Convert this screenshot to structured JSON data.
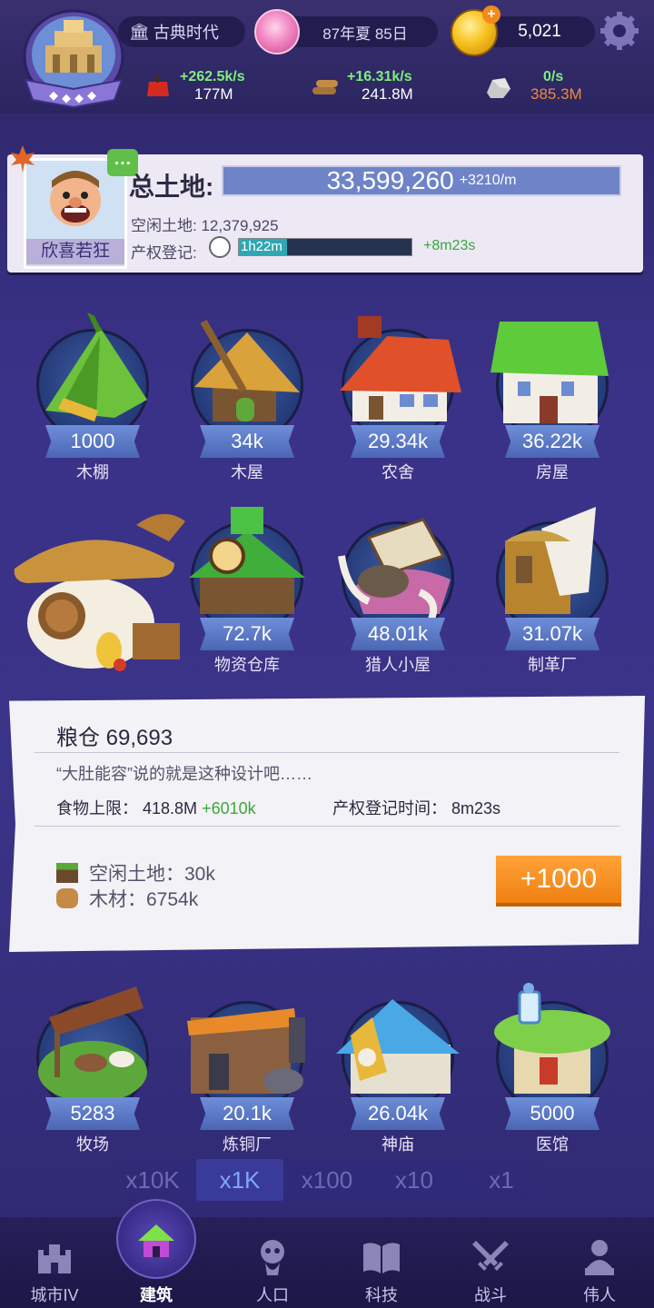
{
  "topbar": {
    "era": "古典时代",
    "date": "87年夏 85日",
    "coins": "5,021",
    "resources": [
      {
        "icon": "apple-icon",
        "rate": "+262.5k/s",
        "amount": "177M"
      },
      {
        "icon": "wood-icon",
        "rate": "+16.31k/s",
        "amount": "241.8M"
      },
      {
        "icon": "stone-icon",
        "rate": "0/s",
        "amount": "385.3M"
      }
    ]
  },
  "land": {
    "leader_name": "欣喜若狂",
    "title": "总土地:",
    "total": "33,599,260",
    "rate": "+3210/m",
    "idle_label": "空闲土地: 12,379,925",
    "register_label": "产权登记:",
    "register_time": "1h22m",
    "register_plus": "+8m23s",
    "register_progress": 0.28
  },
  "buildings_row1": [
    {
      "id": "tent",
      "count": "1000",
      "name": "木棚"
    },
    {
      "id": "hut",
      "count": "34k",
      "name": "木屋"
    },
    {
      "id": "farmhouse",
      "count": "29.34k",
      "name": "农舍"
    },
    {
      "id": "house",
      "count": "36.22k",
      "name": "房屋"
    }
  ],
  "buildings_row2": [
    {
      "id": "granary",
      "count": "",
      "name": ""
    },
    {
      "id": "warehouse",
      "count": "72.7k",
      "name": "物资仓库"
    },
    {
      "id": "hunter",
      "count": "48.01k",
      "name": "猎人小屋"
    },
    {
      "id": "tannery",
      "count": "31.07k",
      "name": "制革厂"
    }
  ],
  "info": {
    "title": "粮仓 69,693",
    "quote": "“大肚能容”说的就是这种设计吧……",
    "food_cap_label": "食物上限：",
    "food_cap_value": "418.8M",
    "food_cap_plus": "+6010k",
    "reg_time_label": "产权登记时间：",
    "reg_time_value": "8m23s",
    "cost_land": "空闲土地：30k",
    "cost_wood": "木材：6754k",
    "build_button": "+1000"
  },
  "buildings_row3": [
    {
      "id": "ranch",
      "count": "5283",
      "name": "牧场"
    },
    {
      "id": "smelter",
      "count": "20.1k",
      "name": "炼铜厂"
    },
    {
      "id": "temple",
      "count": "26.04k",
      "name": "神庙"
    },
    {
      "id": "clinic",
      "count": "5000",
      "name": "医馆"
    }
  ],
  "multipliers": [
    "x10K",
    "x1K",
    "x100",
    "x10",
    "x1"
  ],
  "multiplier_selected": "x1K",
  "nav": [
    {
      "icon": "castle-icon",
      "label": "城市IV"
    },
    {
      "icon": "house-icon",
      "label": "建筑"
    },
    {
      "icon": "person-icon",
      "label": "人口"
    },
    {
      "icon": "book-icon",
      "label": "科技"
    },
    {
      "icon": "crossed-swords-icon",
      "label": "战斗"
    },
    {
      "icon": "bust-icon",
      "label": "伟人"
    }
  ],
  "colors": {
    "background": "#3a3288",
    "accent_green": "#7ef07a",
    "orange_button": "#f08011",
    "banner_blue": "#5a78c6",
    "stone_amount": "#f08a3c"
  }
}
